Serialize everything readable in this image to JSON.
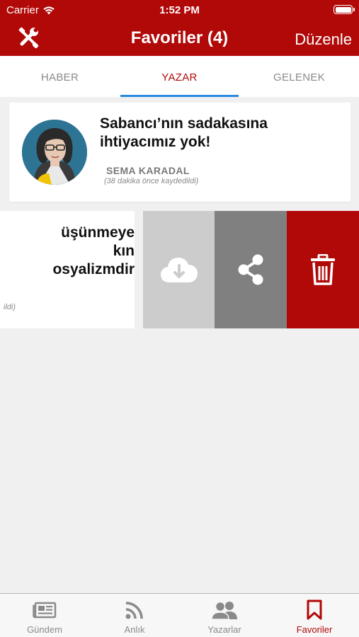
{
  "status_bar": {
    "carrier": "Carrier",
    "time": "1:52 PM"
  },
  "nav": {
    "title": "Favoriler (4)",
    "edit_label": "Düzenle"
  },
  "tabs": [
    {
      "label": "HABER",
      "active": false
    },
    {
      "label": "YAZAR",
      "active": true
    },
    {
      "label": "GELENEK",
      "active": false
    }
  ],
  "favorites": [
    {
      "headline": "Sabancı’nın sadakasına ihtiyacımız yok!",
      "author": "SEMA KARADAL",
      "saved": "(38 dakika önce kaydedildi)"
    },
    {
      "headline_visible": "üşünmeye\nkın\nosyalizmdir",
      "saved_visible": "ildi)"
    }
  ],
  "swipe_actions": {
    "download": "download-icon",
    "share": "share-icon",
    "delete": "trash-icon"
  },
  "bottom_tabs": [
    {
      "label": "Gündem",
      "icon": "newspaper-icon",
      "active": false
    },
    {
      "label": "Anlık",
      "icon": "rss-icon",
      "active": false
    },
    {
      "label": "Yazarlar",
      "icon": "users-icon",
      "active": false
    },
    {
      "label": "Favoriler",
      "icon": "bookmark-icon",
      "active": true
    }
  ],
  "colors": {
    "brand_red": "#b10808",
    "tab_indicator": "#2a8be0"
  }
}
